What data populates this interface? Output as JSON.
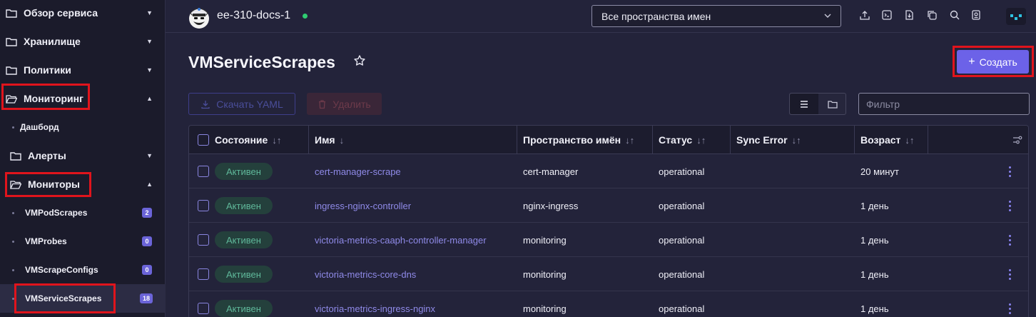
{
  "sidebar": {
    "sections": [
      {
        "label": "Обзор сервиса",
        "expanded": false
      },
      {
        "label": "Хранилище",
        "expanded": false
      },
      {
        "label": "Политики",
        "expanded": false
      },
      {
        "label": "Мониторинг",
        "expanded": true
      }
    ],
    "dashboard_label": "Дашборд",
    "alerts_label": "Алерты",
    "monitors_label": "Мониторы",
    "monitor_items": [
      {
        "label": "VMPodScrapes",
        "count": "2"
      },
      {
        "label": "VMProbes",
        "count": "0"
      },
      {
        "label": "VMScrapeConfigs",
        "count": "0"
      },
      {
        "label": "VMServiceScrapes",
        "count": "18",
        "active": true
      }
    ]
  },
  "topbar": {
    "cluster_name": "ee-310-docs-1",
    "namespace_select": "Все пространства имен",
    "icons": [
      "upload-icon",
      "terminal-icon",
      "download-icon",
      "copy-icon",
      "search-icon",
      "user-badge-icon"
    ]
  },
  "page": {
    "title": "VMServiceScrapes",
    "create_label": "Создать",
    "download_yaml_label": "Скачать YAML",
    "delete_label": "Удалить",
    "filter_placeholder": "Фильтр"
  },
  "table": {
    "columns": [
      "Состояние",
      "Имя",
      "Пространство имён",
      "Статус",
      "Sync Error",
      "Возраст"
    ],
    "rows": [
      {
        "state": "Активен",
        "name": "cert-manager-scrape",
        "namespace": "cert-manager",
        "status": "operational",
        "sync_error": "",
        "age": "20 минут"
      },
      {
        "state": "Активен",
        "name": "ingress-nginx-controller",
        "namespace": "nginx-ingress",
        "status": "operational",
        "sync_error": "",
        "age": "1 день"
      },
      {
        "state": "Активен",
        "name": "victoria-metrics-caaph-controller-manager",
        "namespace": "monitoring",
        "status": "operational",
        "sync_error": "",
        "age": "1 день"
      },
      {
        "state": "Активен",
        "name": "victoria-metrics-core-dns",
        "namespace": "monitoring",
        "status": "operational",
        "sync_error": "",
        "age": "1 день"
      },
      {
        "state": "Активен",
        "name": "victoria-metrics-ingress-nginx",
        "namespace": "monitoring",
        "status": "operational",
        "sync_error": "",
        "age": "1 день"
      }
    ]
  },
  "colors": {
    "accent": "#6c62e8",
    "highlight": "#e0141c",
    "active_badge_bg": "#24403c",
    "active_badge_text": "#5fb89a",
    "link": "#8f8ae8"
  }
}
